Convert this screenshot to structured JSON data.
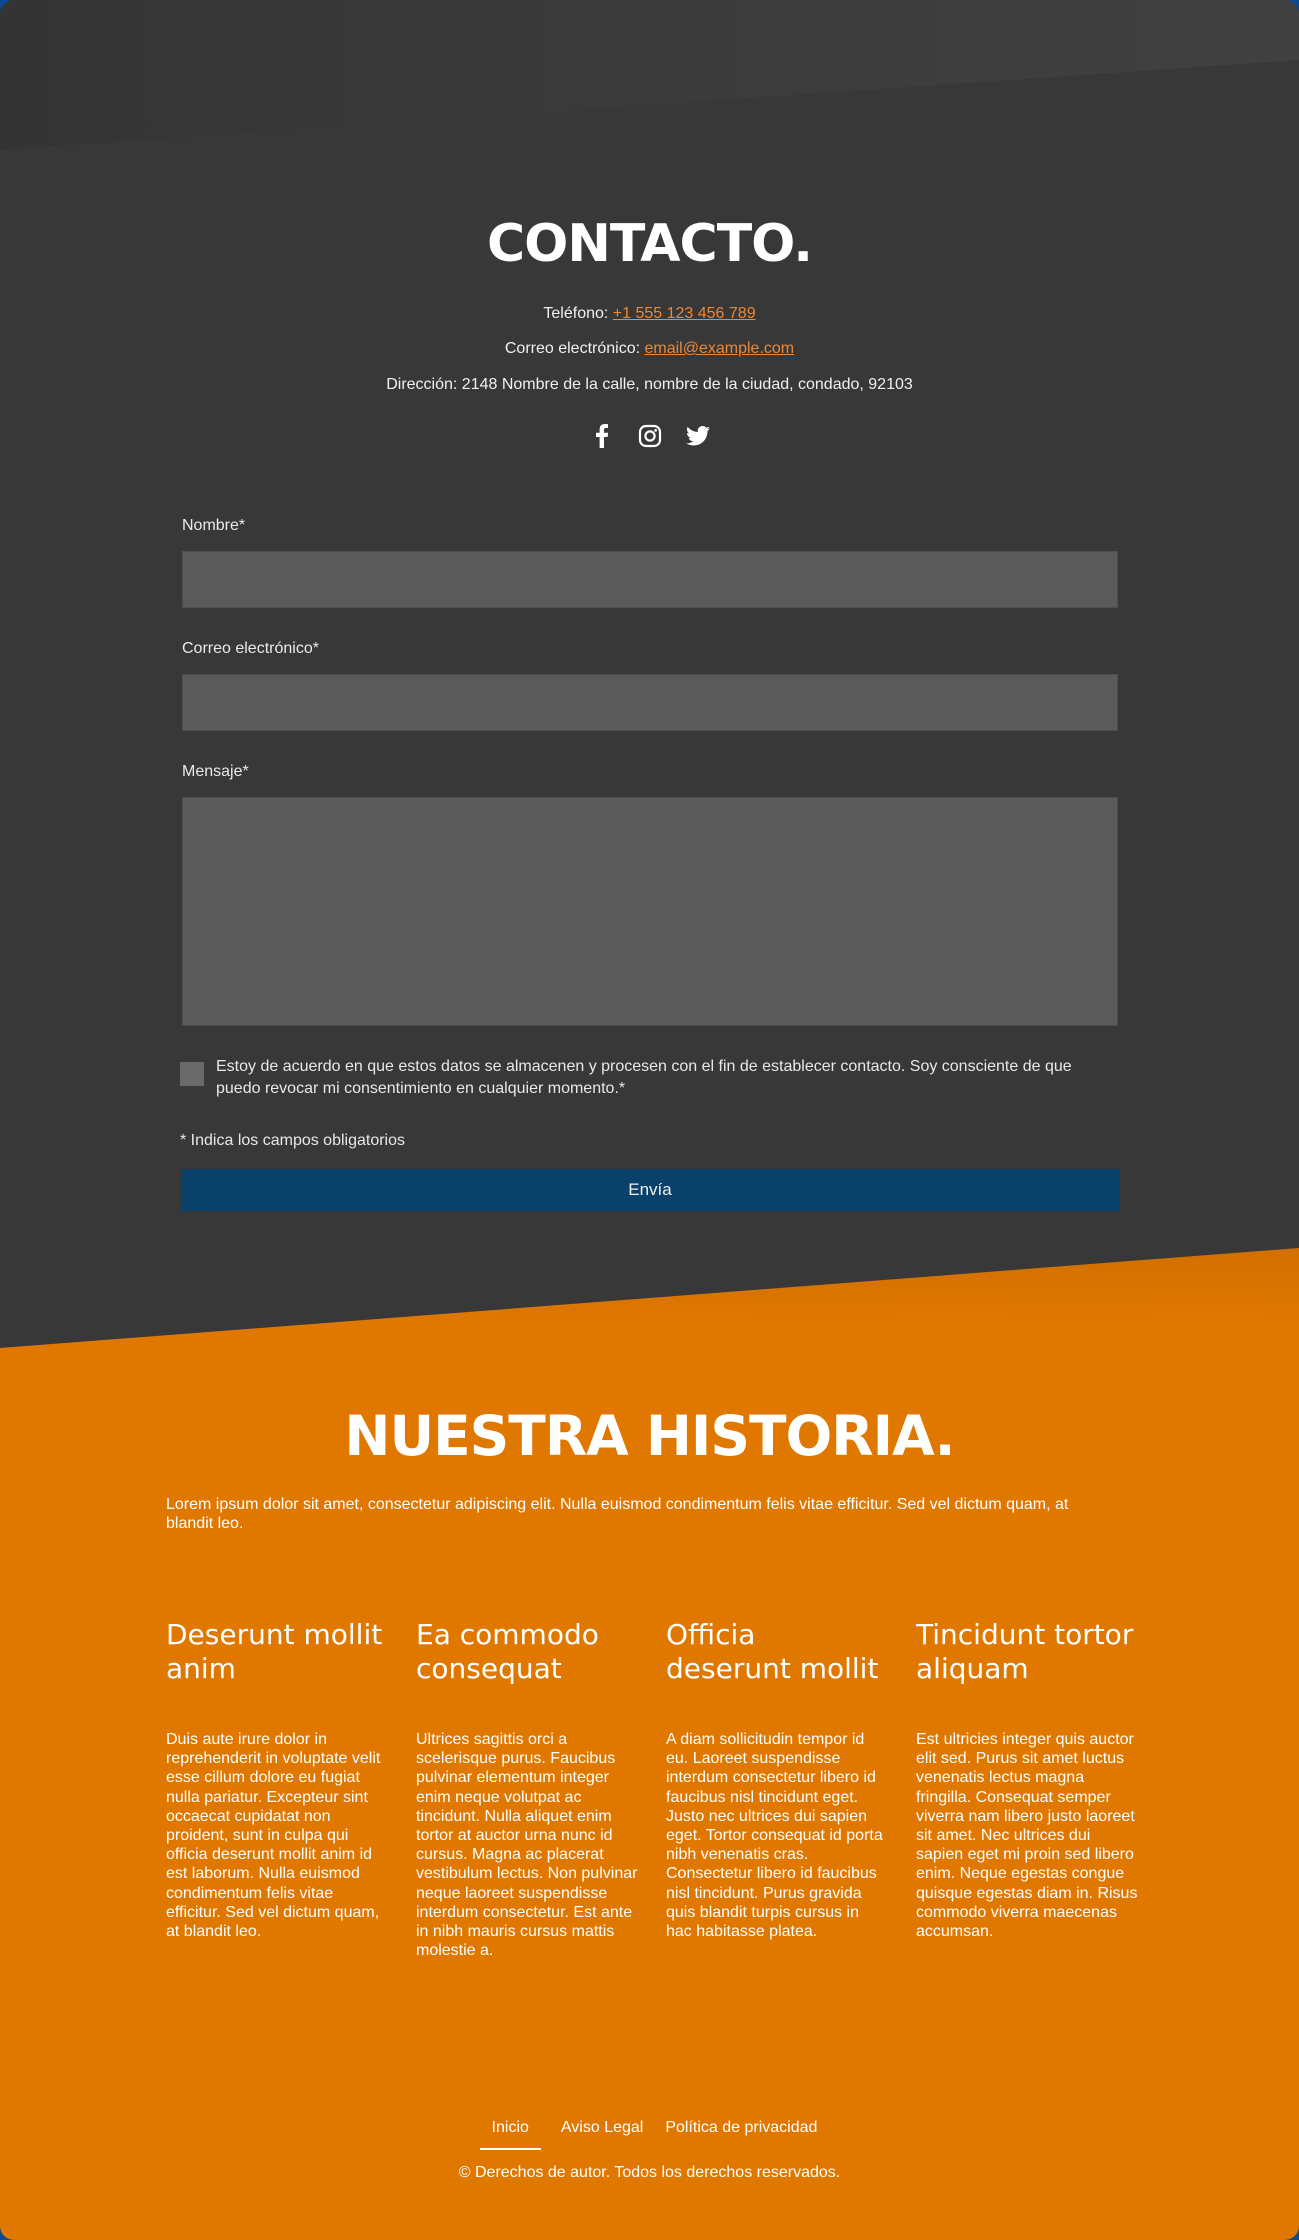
{
  "colors": {
    "dark_bg": "#383838",
    "orange": "#e07800",
    "link": "#e8893a",
    "button": "#0a416b",
    "field": "#5b5a5a"
  },
  "contact": {
    "title": "CONTACTO.",
    "phone_label": "Teléfono: ",
    "phone": "+1 555 123 456 789",
    "email_label": "Correo electrónico: ",
    "email": "email@example.com",
    "address": "Dirección: 2148 Nombre de la calle, nombre de la ciudad, condado, 92103",
    "social": [
      "facebook-icon",
      "instagram-icon",
      "twitter-icon"
    ]
  },
  "form": {
    "name_label": "Nombre*",
    "email_label": "Correo electrónico*",
    "message_label": "Mensaje*",
    "consent": "Estoy de acuerdo en que estos datos se almacenen y procesen con el fin de establecer contacto. Soy consciente de que puedo revocar mi consentimiento en cualquier momento.*",
    "required_note": "* Indica los campos obligatorios",
    "submit": "Envía"
  },
  "history": {
    "title": "NUESTRA HISTORIA.",
    "intro": "Lorem ipsum dolor sit amet, consectetur adipiscing elit. Nulla euismod condimentum felis vitae efficitur. Sed vel dictum quam, at blandit leo.",
    "columns": [
      {
        "heading": "Deserunt mollit anim",
        "text": "Duis aute irure dolor in reprehenderit in voluptate velit esse cillum dolore eu fugiat nulla pariatur. Excepteur sint occaecat cupidatat non proident, sunt in culpa qui officia deserunt mollit anim id est laborum. Nulla euismod condimentum felis vitae efficitur. Sed vel dictum quam, at blandit leo."
      },
      {
        "heading": "Ea commodo consequat",
        "text": "Ultrices sagittis orci a scelerisque purus. Faucibus pulvinar elementum integer enim neque volutpat ac tincidunt. Nulla aliquet enim tortor at auctor urna nunc id cursus. Magna ac placerat vestibulum lectus. Non pulvinar neque laoreet suspendisse interdum consectetur. Est ante in nibh mauris cursus mattis molestie a."
      },
      {
        "heading": "Officia deserunt mollit",
        "text": "A diam sollicitudin tempor id eu. Laoreet suspendisse interdum consectetur libero id faucibus nisl tincidunt eget. Justo nec ultrices dui sapien eget. Tortor consequat id porta nibh venenatis cras. Consectetur libero id faucibus nisl tincidunt. Purus gravida quis blandit turpis cursus in hac habitasse platea."
      },
      {
        "heading": "Tincidunt tortor aliquam",
        "text": "Est ultricies integer quis auctor elit sed. Purus sit amet luctus venenatis lectus magna fringilla. Consequat semper viverra nam libero justo laoreet sit amet. Nec ultrices dui sapien eget mi proin sed libero enim. Neque egestas congue quisque egestas diam in. Risus commodo viverra maecenas accumsan."
      }
    ]
  },
  "footer": {
    "links": [
      "Inicio",
      "Aviso Legal",
      "Política de privacidad"
    ],
    "copyright": "© Derechos de autor. Todos los derechos reservados."
  }
}
